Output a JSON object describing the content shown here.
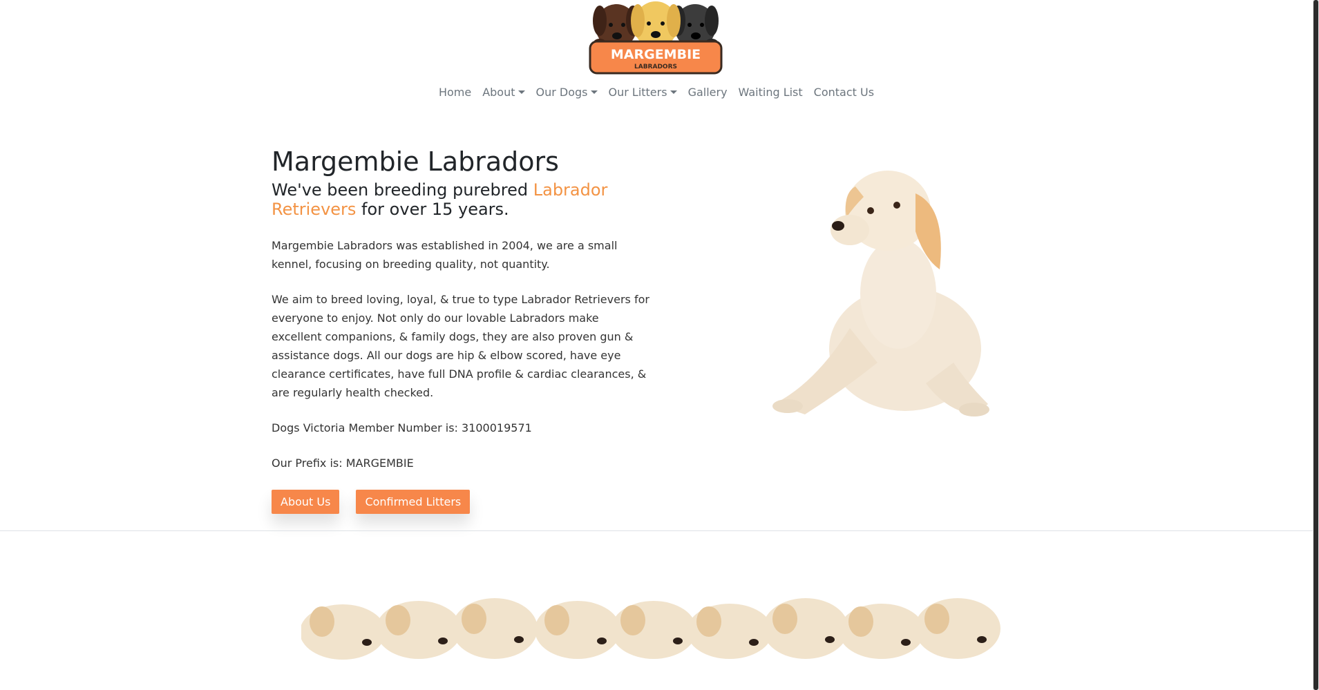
{
  "brand": {
    "logo_text": "MARGEMBIE",
    "logo_subtext": "LABRADORS"
  },
  "nav": {
    "items": [
      {
        "label": "Home"
      },
      {
        "label": "About",
        "dropdown": true
      },
      {
        "label": "Our Dogs",
        "dropdown": true
      },
      {
        "label": "Our Litters",
        "dropdown": true
      },
      {
        "label": "Gallery"
      },
      {
        "label": "Waiting List"
      },
      {
        "label": "Contact Us"
      }
    ]
  },
  "hero": {
    "title": "Margembie Labradors",
    "lead_prefix": "We've been breeding purebred ",
    "lead_accent": "Labrador Retrievers",
    "lead_suffix": " for over 15 years.",
    "paragraphs": [
      "Margembie Labradors was established in 2004, we are a small kennel, focusing on breeding quality, not quantity.",
      "We aim to breed loving, loyal, & true to type Labrador Retrievers for everyone to enjoy. Not only do our lovable Labradors make excellent companions, & family dogs, they are also proven gun & assistance dogs. All our dogs are hip & elbow scored, have eye clearance certificates, have full DNA profile & cardiac clearances, & are regularly health checked.",
      "Dogs Victoria Member Number is: 3100019571",
      "Our Prefix is: MARGEMBIE"
    ],
    "buttons": {
      "about_label": "About Us",
      "litters_label": "Confirmed Litters"
    }
  },
  "colors": {
    "accent": "#f39344",
    "button": "#f7874a",
    "nav_text": "#6c757d"
  }
}
